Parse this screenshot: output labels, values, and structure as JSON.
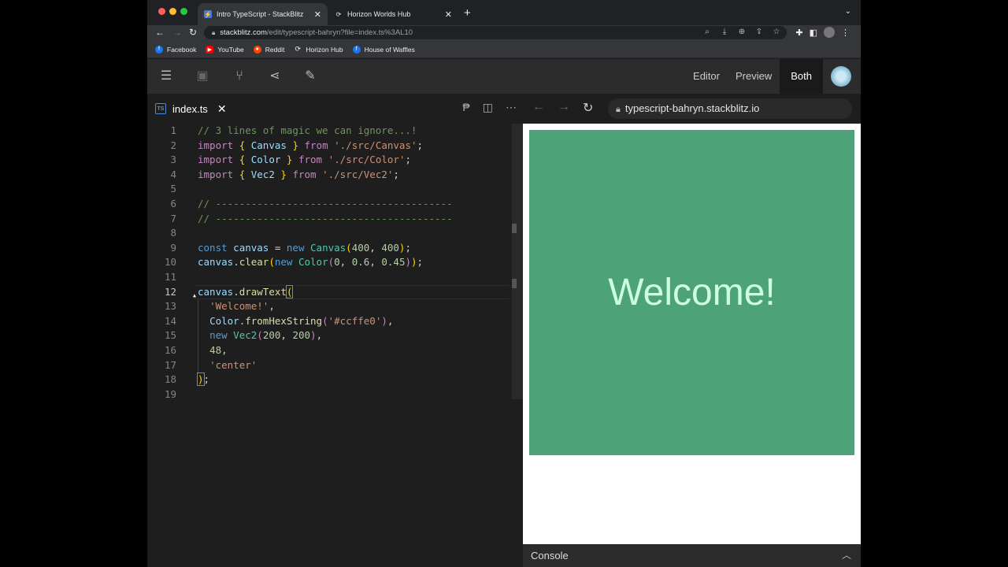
{
  "browser": {
    "tabs": [
      {
        "title": "Intro TypeScript - StackBlitz",
        "active": true
      },
      {
        "title": "Horizon Worlds Hub",
        "active": false
      }
    ],
    "url_host": "stackblitz.com",
    "url_path": "/edit/typescript-bahryn?file=index.ts%3AL10",
    "bookmarks": [
      "Facebook",
      "YouTube",
      "Reddit",
      "Horizon Hub",
      "House of Waffles"
    ]
  },
  "stackblitz": {
    "view_buttons": {
      "editor": "Editor",
      "preview": "Preview",
      "both": "Both"
    },
    "active_view": "Both",
    "file_tab": "index.ts",
    "preview_url": "typescript-bahryn.stackblitz.io",
    "console_label": "Console"
  },
  "editor": {
    "current_line": 12,
    "line_numbers": [
      "1",
      "2",
      "3",
      "4",
      "5",
      "6",
      "7",
      "8",
      "9",
      "10",
      "11",
      "12",
      "13",
      "14",
      "15",
      "16",
      "17",
      "18",
      "19"
    ]
  },
  "preview": {
    "canvas_text": "Welcome!",
    "canvas_bg": "#4da277",
    "text_color": "#ccffe0"
  },
  "colors": {
    "editor_bg": "#1e1e1e",
    "accent": "#569cd6"
  }
}
